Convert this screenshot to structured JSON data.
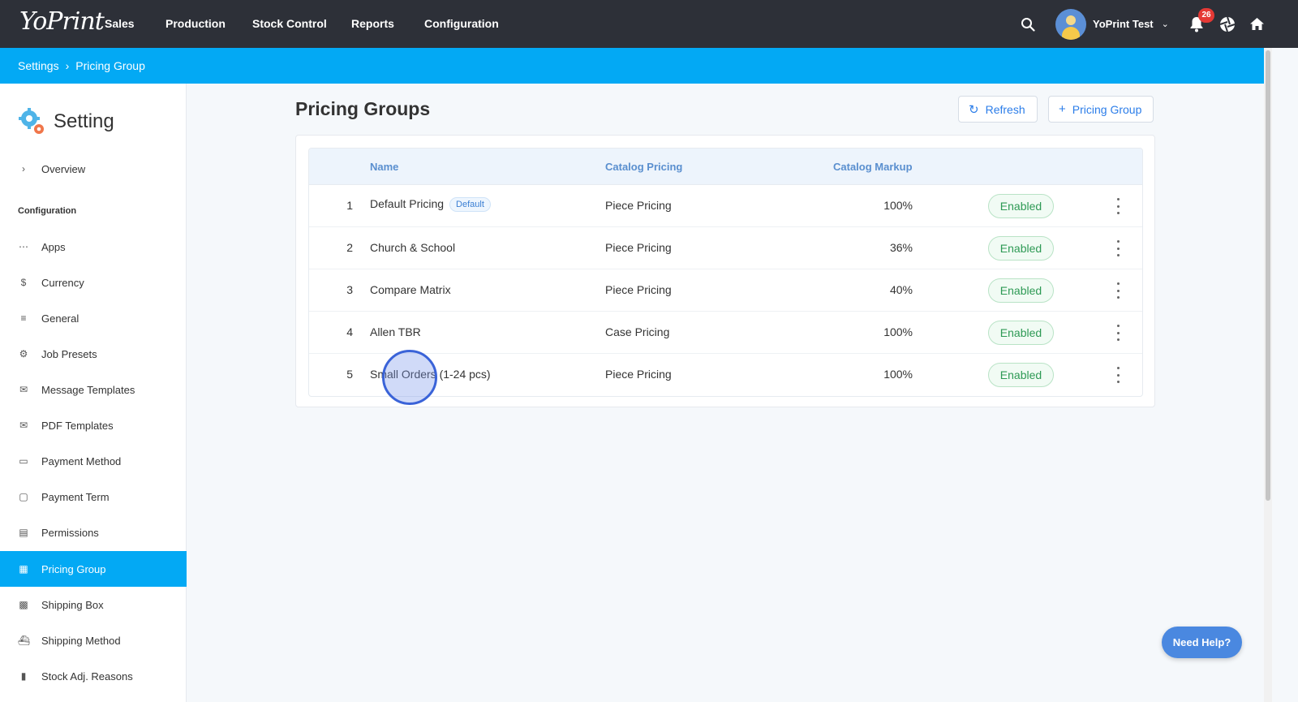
{
  "app": {
    "logo": "YoPrint",
    "nav": [
      "Sales",
      "Production",
      "Stock Control",
      "Reports",
      "Configuration"
    ],
    "user_name": "YoPrint Test",
    "notification_count": "26"
  },
  "breadcrumb": {
    "root": "Settings",
    "current": "Pricing Group"
  },
  "sidebar": {
    "title": "Setting",
    "overview": "Overview",
    "section": "Configuration",
    "items": [
      {
        "label": "Apps",
        "icon": "apps-grid-icon"
      },
      {
        "label": "Currency",
        "icon": "dollar-icon"
      },
      {
        "label": "General",
        "icon": "sliders-icon"
      },
      {
        "label": "Job Presets",
        "icon": "gear-icon"
      },
      {
        "label": "Message Templates",
        "icon": "envelope-icon"
      },
      {
        "label": "PDF Templates",
        "icon": "envelope-icon"
      },
      {
        "label": "Payment Method",
        "icon": "credit-card-icon"
      },
      {
        "label": "Payment Term",
        "icon": "clipboard-icon"
      },
      {
        "label": "Permissions",
        "icon": "badge-icon"
      },
      {
        "label": "Pricing Group",
        "icon": "calendar-icon"
      },
      {
        "label": "Shipping Box",
        "icon": "box-icon"
      },
      {
        "label": "Shipping Method",
        "icon": "ship-icon"
      },
      {
        "label": "Stock Adj. Reasons",
        "icon": "feedback-icon"
      }
    ],
    "active": "Pricing Group"
  },
  "main": {
    "title": "Pricing Groups",
    "refresh_label": "Refresh",
    "add_label": "Pricing Group",
    "columns": {
      "name": "Name",
      "catalog_pricing": "Catalog Pricing",
      "catalog_markup": "Catalog Markup"
    },
    "rows": [
      {
        "index": "1",
        "name": "Default Pricing",
        "tag": "Default",
        "pricing": "Piece Pricing",
        "markup": "100%",
        "status": "Enabled"
      },
      {
        "index": "2",
        "name": "Church & School",
        "tag": "",
        "pricing": "Piece Pricing",
        "markup": "36%",
        "status": "Enabled"
      },
      {
        "index": "3",
        "name": "Compare Matrix",
        "tag": "",
        "pricing": "Piece Pricing",
        "markup": "40%",
        "status": "Enabled"
      },
      {
        "index": "4",
        "name": "Allen TBR",
        "tag": "",
        "pricing": "Case Pricing",
        "markup": "100%",
        "status": "Enabled"
      },
      {
        "index": "5",
        "name": "Small Orders (1-24 pcs)",
        "tag": "",
        "pricing": "Piece Pricing",
        "markup": "100%",
        "status": "Enabled"
      }
    ]
  },
  "help_label": "Need Help?",
  "colors": {
    "topbar": "#2d3038",
    "accent": "#03a9f4",
    "link": "#2b7de9",
    "enabled": "#2e9a55"
  }
}
